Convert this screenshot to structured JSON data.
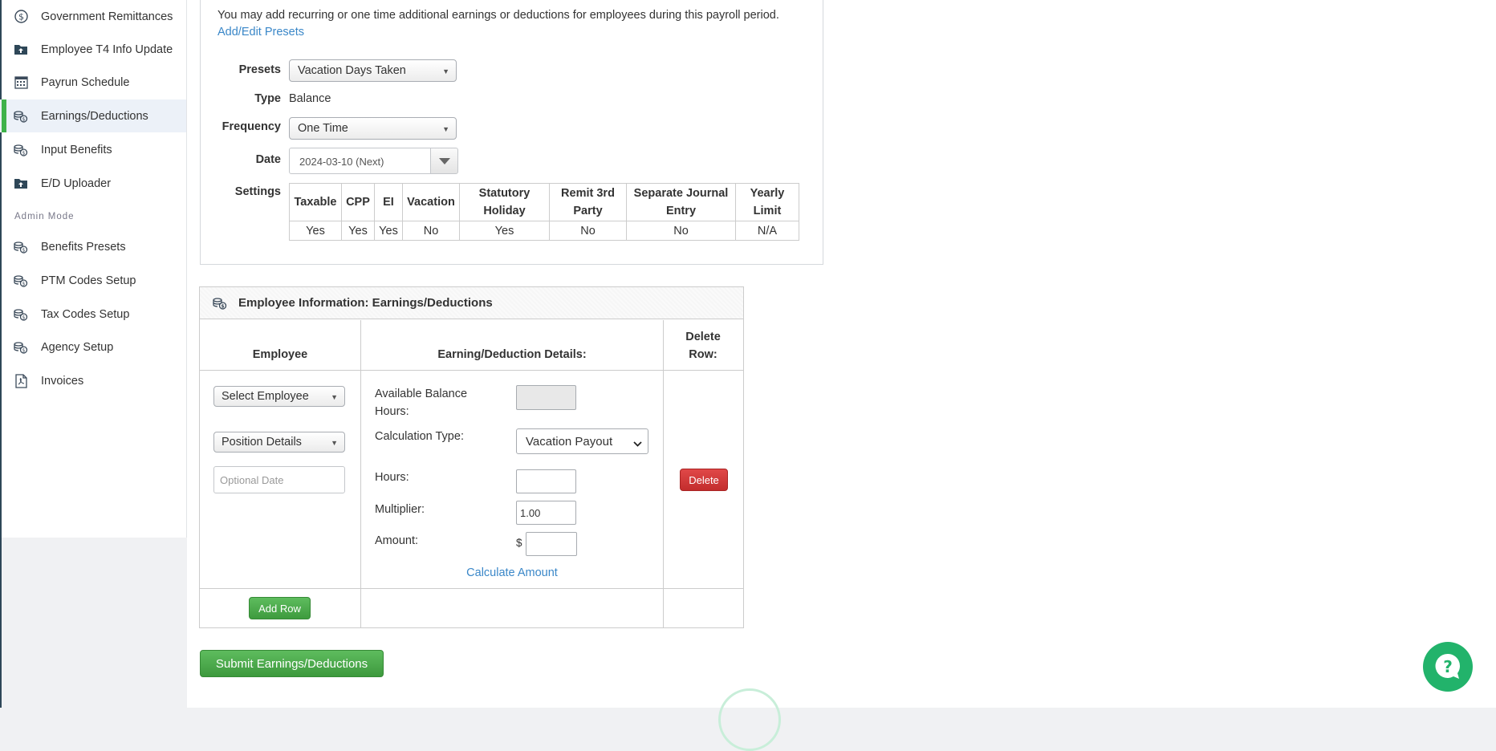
{
  "sidebar": {
    "items": [
      {
        "label": "Government Remittances",
        "icon": "dollar-circle-icon"
      },
      {
        "label": "Employee T4 Info Update",
        "icon": "folder-upload-icon"
      },
      {
        "label": "Payrun Schedule",
        "icon": "calendar-icon"
      },
      {
        "label": "Earnings/Deductions",
        "icon": "coins-icon",
        "active": true
      },
      {
        "label": "Input Benefits",
        "icon": "coins-icon"
      },
      {
        "label": "E/D Uploader",
        "icon": "folder-upload-icon"
      }
    ],
    "section_label": "Admin Mode",
    "admin_items": [
      {
        "label": "Benefits Presets",
        "icon": "coins-icon"
      },
      {
        "label": "PTM Codes Setup",
        "icon": "coins-icon"
      },
      {
        "label": "Tax Codes Setup",
        "icon": "coins-icon"
      },
      {
        "label": "Agency Setup",
        "icon": "coins-icon"
      },
      {
        "label": "Invoices",
        "icon": "pdf-icon"
      }
    ]
  },
  "form": {
    "intro_text": "You may add recurring or one time additional earnings or deductions for employees during this payroll period.",
    "presets_link": "Add/Edit Presets",
    "presets_label": "Presets",
    "presets_value": "Vacation Days Taken",
    "type_label": "Type",
    "type_value": "Balance",
    "frequency_label": "Frequency",
    "frequency_value": "One Time",
    "date_label": "Date",
    "date_value": "2024-03-10 (Next)",
    "settings_label": "Settings",
    "settings_headers": [
      "Taxable",
      "CPP",
      "EI",
      "Vacation",
      "Statutory Holiday",
      "Remit 3rd Party",
      "Separate Journal Entry",
      "Yearly Limit"
    ],
    "settings_values": [
      "Yes",
      "Yes",
      "Yes",
      "No",
      "Yes",
      "No",
      "No",
      "N/A"
    ]
  },
  "employee_panel": {
    "title": "Employee Information: Earnings/Deductions",
    "col_employee": "Employee",
    "col_details": "Earning/Deduction Details:",
    "col_delete": "Delete Row:",
    "select_employee": "Select Employee",
    "position_details": "Position Details",
    "optional_date_placeholder": "Optional Date",
    "available_balance_label": "Available Balance Hours:",
    "calc_type_label": "Calculation Type:",
    "calc_type_value": "Vacation Payout",
    "hours_label": "Hours:",
    "hours_value": "",
    "multiplier_label": "Multiplier:",
    "multiplier_value": "1.00",
    "amount_label": "Amount:",
    "currency_symbol": "$",
    "amount_value": "",
    "calculate_link": "Calculate Amount",
    "delete_button": "Delete",
    "add_row_button": "Add Row"
  },
  "submit_button": "Submit Earnings/Deductions",
  "colors": {
    "accent_green": "#3fb24a",
    "link_blue": "#3a87c8",
    "danger_red": "#d03a3a",
    "help_green": "#22b36b"
  }
}
